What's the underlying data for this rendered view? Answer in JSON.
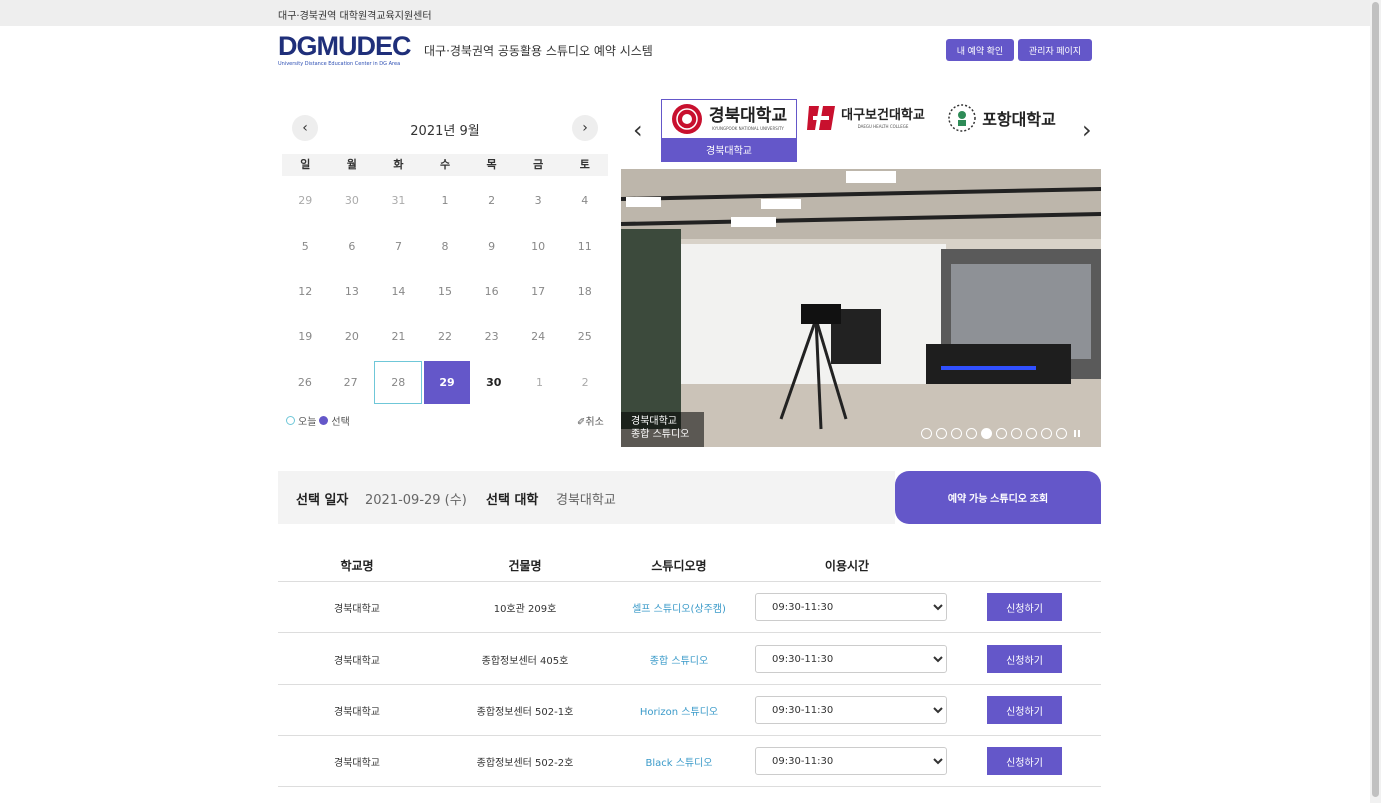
{
  "header": {
    "topbar_text": "대구·경북권역 대학원격교육지원센터",
    "logo_main": "DGMUDEC",
    "logo_sub": "University Distance Education Center in DG Area",
    "system_title": "대구·경북권역 공동활용 스튜디오 예약 시스템",
    "my_reservation_label": "내 예약 확인",
    "admin_label": "관리자 페이지"
  },
  "calendar": {
    "title": "2021년 9월",
    "weekdays": [
      "일",
      "월",
      "화",
      "수",
      "목",
      "금",
      "토"
    ],
    "weeks": [
      [
        "29",
        "30",
        "31",
        "1",
        "2",
        "3",
        "4"
      ],
      [
        "5",
        "6",
        "7",
        "8",
        "9",
        "10",
        "11"
      ],
      [
        "12",
        "13",
        "14",
        "15",
        "16",
        "17",
        "18"
      ],
      [
        "19",
        "20",
        "21",
        "22",
        "23",
        "24",
        "25"
      ],
      [
        "26",
        "27",
        "28",
        "29",
        "30",
        "1",
        "2"
      ]
    ],
    "legend_today": "오늘",
    "legend_selected": "선택",
    "cancel_label": "취소"
  },
  "universities": [
    {
      "name": "경북대학교",
      "logo_text": "경북대학교",
      "logo_sub": "KYUNGPOOK NATIONAL UNIVERSITY",
      "color": "#c8102e"
    },
    {
      "logo_text": "대구보건대학교",
      "logo_sub": "DAEGU HEALTH COLLEGE",
      "color": "#c8102e"
    },
    {
      "logo_text": "포항대학교",
      "color": "#333333"
    }
  ],
  "slide": {
    "caption_line1": "경북대학교",
    "caption_line2": "종합 스튜디오",
    "dot_count": 10,
    "active_dot": 4
  },
  "selection": {
    "date_label": "선택 일자",
    "date_value": "2021-09-29 (수)",
    "uni_label": "선택 대학",
    "uni_value": "경북대학교",
    "search_label": "예약 가능 스튜디오 조회"
  },
  "table": {
    "columns": [
      "학교명",
      "건물명",
      "스튜디오명",
      "이용시간"
    ],
    "rows": [
      {
        "school": "경북대학교",
        "building": "10호관 209호",
        "studio": "셀프 스튜디오(상주캠)",
        "time": "09:30-11:30",
        "action": "신청하기"
      },
      {
        "school": "경북대학교",
        "building": "종합정보센터 405호",
        "studio": "종합 스튜디오",
        "time": "09:30-11:30",
        "action": "신청하기"
      },
      {
        "school": "경북대학교",
        "building": "종합정보센터 502-1호",
        "studio": "Horizon 스튜디오",
        "time": "09:30-11:30",
        "action": "신청하기"
      },
      {
        "school": "경북대학교",
        "building": "종합정보센터 502-2호",
        "studio": "Black 스튜디오",
        "time": "09:30-11:30",
        "action": "신청하기"
      }
    ]
  },
  "colors": {
    "accent": "#6457c9",
    "today_ring": "#6fc7d8",
    "link": "#3a9ac9"
  }
}
